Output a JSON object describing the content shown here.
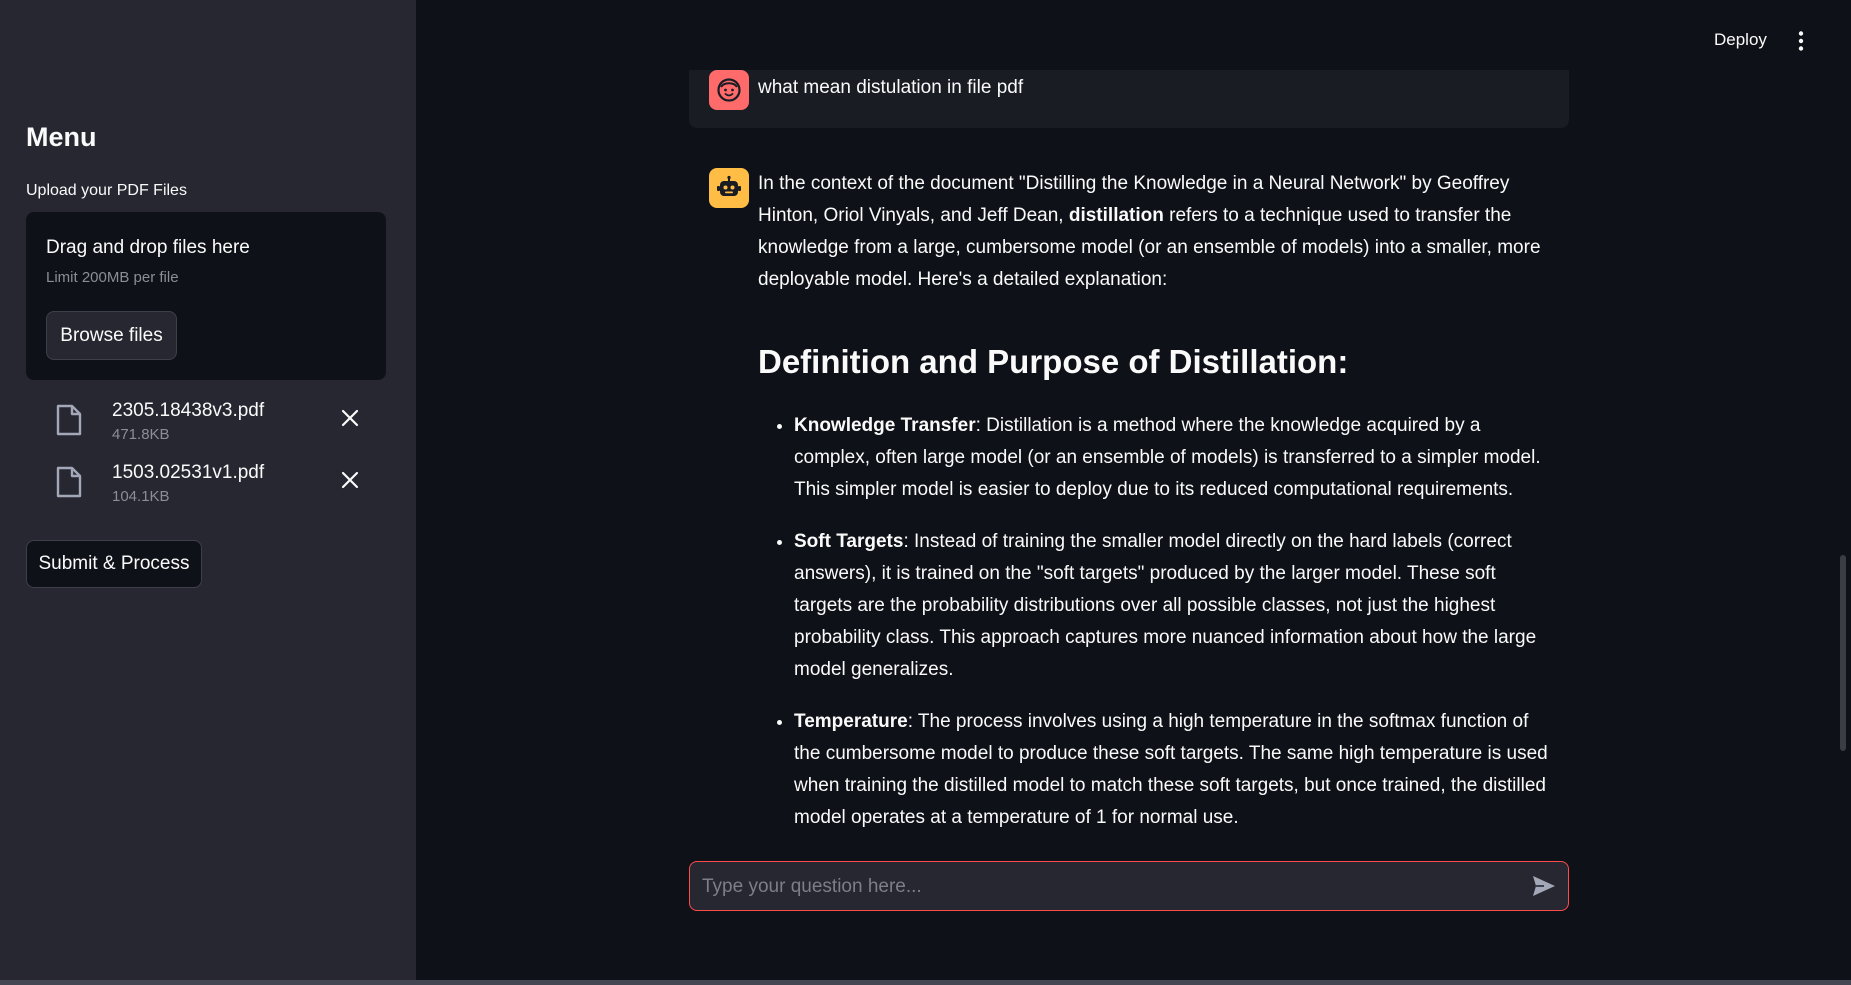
{
  "sidebar": {
    "menu_title": "Menu",
    "upload_label": "Upload your PDF Files",
    "dropzone": {
      "title": "Drag and drop files here",
      "limit": "Limit 200MB per file",
      "browse_label": "Browse files"
    },
    "files": [
      {
        "name": "2305.18438v3.pdf",
        "size": "471.8KB"
      },
      {
        "name": "1503.02531v1.pdf",
        "size": "104.1KB"
      }
    ],
    "submit_label": "Submit & Process"
  },
  "header": {
    "deploy_label": "Deploy",
    "more_icon": "more-vertical-icon"
  },
  "chat": {
    "user_message": "what mean distulation in file pdf",
    "assistant": {
      "intro_part1": "In the context of the document \"Distilling the Knowledge in a Neural Network\" by Geoffrey Hinton, Oriol Vinyals, and Jeff Dean, ",
      "intro_bold": "distillation",
      "intro_part2": " refers to a technique used to transfer the knowledge from a large, cumbersome model (or an ensemble of models) into a smaller, more deployable model. Here's a detailed explanation:",
      "heading": "Definition and Purpose of Distillation:",
      "bullets": [
        {
          "term": "Knowledge Transfer",
          "text": ": Distillation is a method where the knowledge acquired by a complex, often large model (or an ensemble of models) is transferred to a simpler model. This simpler model is easier to deploy due to its reduced computational requirements."
        },
        {
          "term": "Soft Targets",
          "text": ": Instead of training the smaller model directly on the hard labels (correct answers), it is trained on the \"soft targets\" produced by the larger model. These soft targets are the probability distributions over all possible classes, not just the highest probability class. This approach captures more nuanced information about how the large model generalizes."
        },
        {
          "term": "Temperature",
          "text": ": The process involves using a high temperature in the softmax function of the cumbersome model to produce these soft targets. The same high temperature is used when training the distilled model to match these soft targets, but once trained, the distilled model operates at a temperature of 1 for normal use."
        }
      ]
    }
  },
  "input": {
    "placeholder": "Type your question here...",
    "value": ""
  },
  "colors": {
    "sidebar_bg": "#262730",
    "main_bg": "#0e1117",
    "accent": "#ff4b4b",
    "user_avatar": "#ff6b6b",
    "bot_avatar": "#ffbd45"
  }
}
